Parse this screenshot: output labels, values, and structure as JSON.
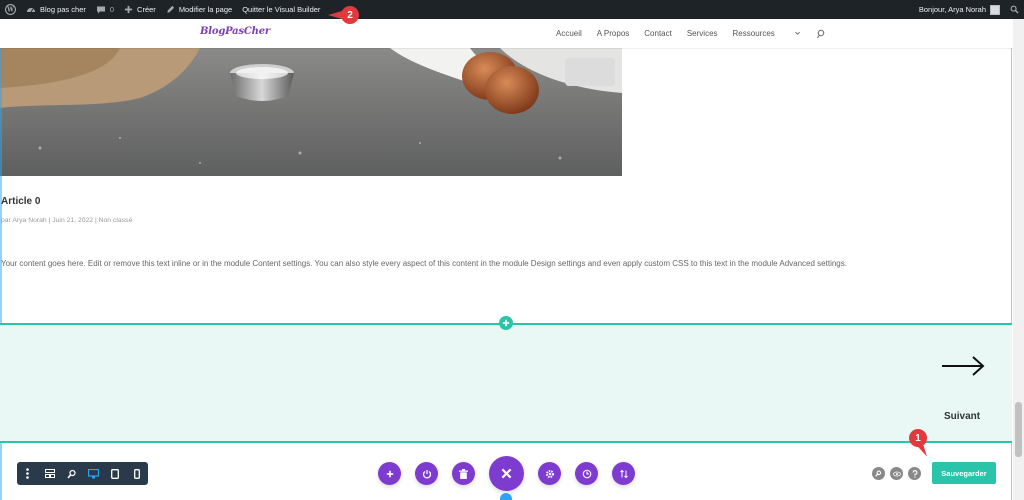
{
  "admin_bar": {
    "site_name": "Blog pas cher",
    "comments_count": "0",
    "new_label": "Créer",
    "edit_label": "Modifier la page",
    "exit_label": "Quitter le Visual Builder",
    "greeting": "Bonjour, Arya Norah"
  },
  "annotations": {
    "step1": "1",
    "step2": "2"
  },
  "site": {
    "logo": "BlogPasCher",
    "nav": [
      "Accueil",
      "A Propos",
      "Contact",
      "Services",
      "Ressources"
    ]
  },
  "article": {
    "title": "Article 0",
    "meta": "par Arya Norah | Juin 21, 2022 | Non classé",
    "body": "Your content goes here. Edit or remove this text inline or in the module Content settings. You can also style every aspect of this content in the module Design settings and even apply custom CSS to this text in the module Advanced settings."
  },
  "pagination": {
    "next_label": "Suivant"
  },
  "builder": {
    "save_label": "Sauvegarder"
  },
  "colors": {
    "admin_bar": "#1d2327",
    "accent_teal": "#29c4a9",
    "builder_purple": "#7e3bd0",
    "annotation_red": "#e0393e",
    "section_bg": "#e9f8f5"
  },
  "icons": [
    "wordpress-icon",
    "dashboard-icon",
    "comment-icon",
    "plus-icon",
    "pencil-icon",
    "search-icon",
    "arrow-right-icon",
    "close-icon",
    "power-icon",
    "trash-icon",
    "gear-icon",
    "history-icon",
    "sort-icon",
    "zoom-icon",
    "eye-icon",
    "help-icon",
    "desktop-icon",
    "tablet-icon",
    "phone-icon",
    "layout-icon",
    "menu-dots-icon"
  ]
}
